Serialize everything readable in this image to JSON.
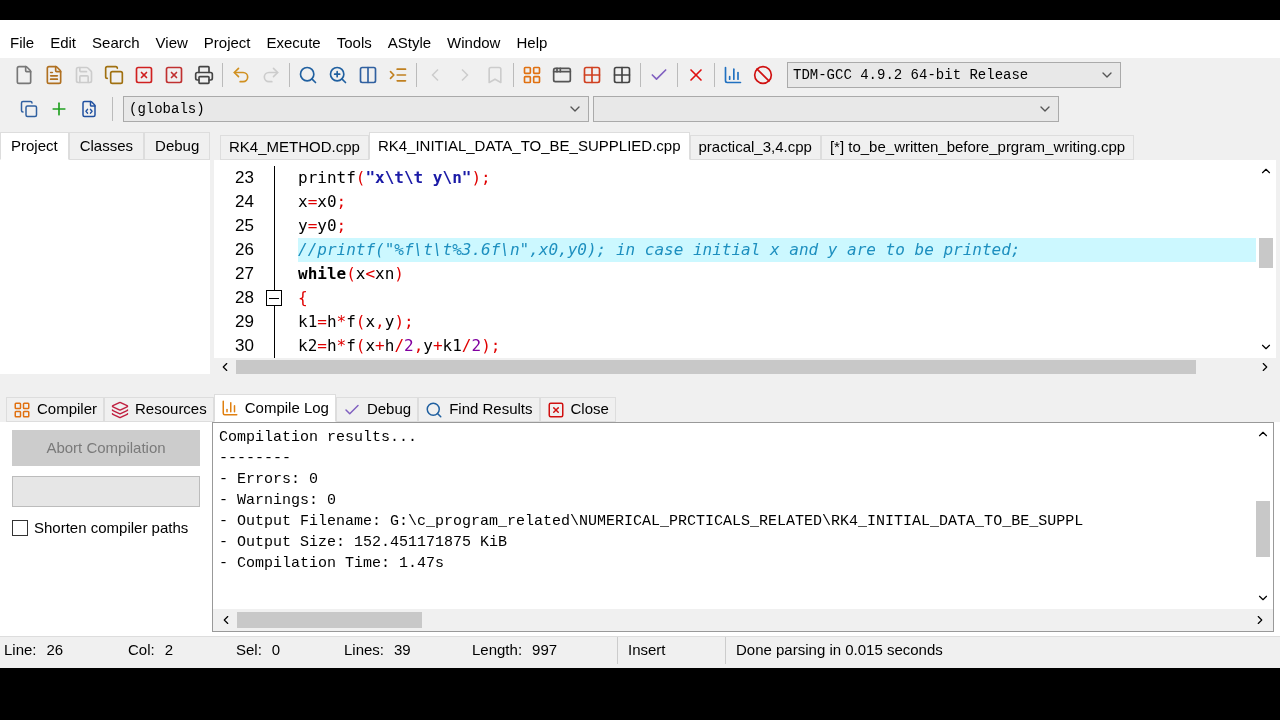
{
  "menu": [
    "File",
    "Edit",
    "Search",
    "View",
    "Project",
    "Execute",
    "Tools",
    "AStyle",
    "Window",
    "Help"
  ],
  "toolbar": [
    {
      "disabled": false
    },
    {
      "disabled": false
    },
    {
      "disabled": true
    },
    {
      "disabled": false
    },
    {
      "disabled": false
    },
    {
      "disabled": false
    },
    {
      "disabled": false
    },
    {
      "disabled": false
    },
    {
      "disabled": true
    },
    {
      "disabled": false
    },
    {
      "disabled": false
    },
    {
      "disabled": false
    },
    {
      "disabled": false
    },
    {
      "disabled": true
    },
    {
      "disabled": true
    },
    {
      "disabled": true
    },
    {
      "disabled": false
    },
    {
      "disabled": false
    },
    {
      "disabled": false
    },
    {
      "disabled": false
    },
    {
      "disabled": false
    },
    {
      "disabled": false
    },
    {
      "disabled": false
    },
    {
      "disabled": false
    }
  ],
  "compiler_select": {
    "value": "TDM-GCC 4.9.2 64-bit Release"
  },
  "scope_select": {
    "value": "(globals)"
  },
  "side_tabs": [
    {
      "label": "Project",
      "selected": true
    },
    {
      "label": "Classes",
      "selected": false
    },
    {
      "label": "Debug",
      "selected": false
    }
  ],
  "file_tabs": [
    {
      "label": "RK4_METHOD.cpp",
      "selected": false
    },
    {
      "label": "RK4_INITIAL_DATA_TO_BE_SUPPLIED.cpp",
      "selected": true
    },
    {
      "label": "practical_3,4.cpp",
      "selected": false
    },
    {
      "label": "[*] to_be_written_before_prgram_writing.cpp",
      "selected": false
    }
  ],
  "code_lines": [
    {
      "number": "23",
      "current": false,
      "fold": false,
      "tokens": [
        {
          "kind": "plain",
          "text": "printf"
        },
        {
          "kind": "op",
          "text": "("
        },
        {
          "kind": "str",
          "text": "\"x\\t\\t y\\n\""
        },
        {
          "kind": "op",
          "text": ");"
        }
      ]
    },
    {
      "number": "24",
      "current": false,
      "fold": false,
      "tokens": [
        {
          "kind": "plain",
          "text": "x"
        },
        {
          "kind": "op",
          "text": "="
        },
        {
          "kind": "plain",
          "text": "x0"
        },
        {
          "kind": "op",
          "text": ";"
        }
      ]
    },
    {
      "number": "25",
      "current": false,
      "fold": false,
      "tokens": [
        {
          "kind": "plain",
          "text": "y"
        },
        {
          "kind": "op",
          "text": "="
        },
        {
          "kind": "plain",
          "text": "y0"
        },
        {
          "kind": "op",
          "text": ";"
        }
      ]
    },
    {
      "number": "26",
      "current": true,
      "fold": false,
      "tokens": [
        {
          "kind": "comment",
          "text": "//printf(\"%f\\t\\t%3.6f\\n\",x0,y0); in case initial x and y are to be printed;"
        }
      ]
    },
    {
      "number": "27",
      "current": false,
      "fold": false,
      "tokens": [
        {
          "kind": "kw",
          "text": "while"
        },
        {
          "kind": "op",
          "text": "("
        },
        {
          "kind": "plain",
          "text": "x"
        },
        {
          "kind": "op",
          "text": "<"
        },
        {
          "kind": "plain",
          "text": "xn"
        },
        {
          "kind": "op",
          "text": ")"
        }
      ]
    },
    {
      "number": "28",
      "current": false,
      "fold": true,
      "tokens": [
        {
          "kind": "op",
          "text": "{"
        }
      ]
    },
    {
      "number": "29",
      "current": false,
      "fold": false,
      "tokens": [
        {
          "kind": "plain",
          "text": "k1"
        },
        {
          "kind": "op",
          "text": "="
        },
        {
          "kind": "plain",
          "text": "h"
        },
        {
          "kind": "op",
          "text": "*"
        },
        {
          "kind": "plain",
          "text": "f"
        },
        {
          "kind": "op",
          "text": "("
        },
        {
          "kind": "plain",
          "text": "x"
        },
        {
          "kind": "op",
          "text": ","
        },
        {
          "kind": "plain",
          "text": "y"
        },
        {
          "kind": "op",
          "text": ");"
        }
      ]
    },
    {
      "number": "30",
      "current": false,
      "fold": false,
      "tokens": [
        {
          "kind": "plain",
          "text": "k2"
        },
        {
          "kind": "op",
          "text": "="
        },
        {
          "kind": "plain",
          "text": "h"
        },
        {
          "kind": "op",
          "text": "*"
        },
        {
          "kind": "plain",
          "text": "f"
        },
        {
          "kind": "op",
          "text": "("
        },
        {
          "kind": "plain",
          "text": "x"
        },
        {
          "kind": "op",
          "text": "+"
        },
        {
          "kind": "plain",
          "text": "h"
        },
        {
          "kind": "op",
          "text": "/"
        },
        {
          "kind": "num",
          "text": "2"
        },
        {
          "kind": "op",
          "text": ","
        },
        {
          "kind": "plain",
          "text": "y"
        },
        {
          "kind": "op",
          "text": "+"
        },
        {
          "kind": "plain",
          "text": "k1"
        },
        {
          "kind": "op",
          "text": "/"
        },
        {
          "kind": "num",
          "text": "2"
        },
        {
          "kind": "op",
          "text": ");"
        }
      ]
    }
  ],
  "bottom_tabs": [
    {
      "label": "Compiler",
      "selected": false
    },
    {
      "label": "Resources",
      "selected": false
    },
    {
      "label": "Compile Log",
      "selected": true
    },
    {
      "label": "Debug",
      "selected": false
    },
    {
      "label": "Find Results",
      "selected": false
    },
    {
      "label": "Close",
      "selected": false
    }
  ],
  "abort_button": {
    "label": "Abort Compilation",
    "disabled": true
  },
  "shorten_paths": {
    "label": "Shorten compiler paths",
    "checked": false
  },
  "log_lines": [
    "Compilation results...",
    "--------",
    "- Errors: 0",
    "- Warnings: 0",
    "- Output Filename: G:\\c_program_related\\NUMERICAL_PRCTICALS_RELATED\\RK4_INITIAL_DATA_TO_BE_SUPPL",
    "- Output Size: 152.451171875 KiB",
    "- Compilation Time: 1.47s"
  ],
  "status_bar": [
    {
      "label": "Line:",
      "value": "26"
    },
    {
      "label": "Col:",
      "value": "2"
    },
    {
      "label": "Sel:",
      "value": "0"
    },
    {
      "label": "Lines:",
      "value": "39"
    },
    {
      "label": "Length:",
      "value": "997"
    },
    {
      "value": "Insert"
    },
    {
      "value": "Done parsing in 0.015 seconds"
    }
  ]
}
